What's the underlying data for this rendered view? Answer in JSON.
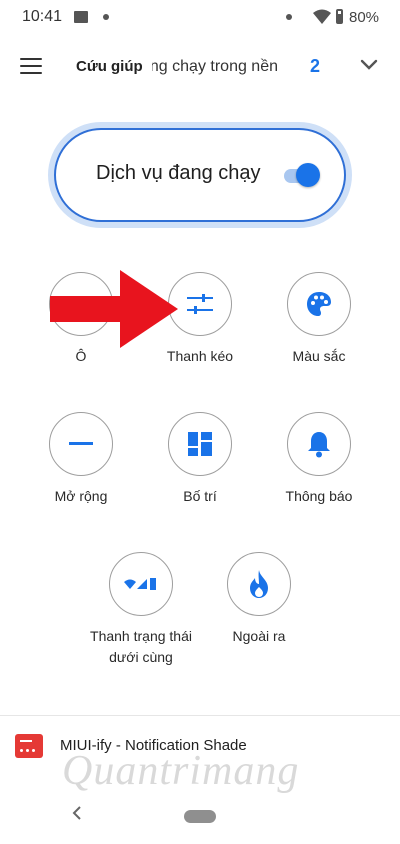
{
  "status": {
    "time": "10:41",
    "battery": "80%"
  },
  "header": {
    "help_tab": "Cứu giúp",
    "background_tab": "Dịch vụ đang chạy trong nền",
    "count": "2"
  },
  "service": {
    "label": "Dịch vụ đang chạy",
    "enabled": true
  },
  "options": [
    {
      "label": "Ô",
      "icon": "two-dots-icon"
    },
    {
      "label": "Thanh kéo",
      "icon": "sliders-icon"
    },
    {
      "label": "Màu sắc",
      "icon": "palette-icon"
    },
    {
      "label": "Mở rộng",
      "icon": "minus-icon"
    },
    {
      "label": "Bố trí",
      "icon": "layout-grid-icon"
    },
    {
      "label": "Thông báo",
      "icon": "bell-icon"
    },
    {
      "label": "Thanh trạng thái dưới cùng",
      "icon": "status-bar-icon"
    },
    {
      "label": "Ngoài ra",
      "icon": "flame-icon"
    }
  ],
  "notification": {
    "text": "MIUI-ify - Notification Shade"
  },
  "watermark": "Quantrimang",
  "colors": {
    "accent": "#1a73e8",
    "arrow": "#e8141e"
  }
}
